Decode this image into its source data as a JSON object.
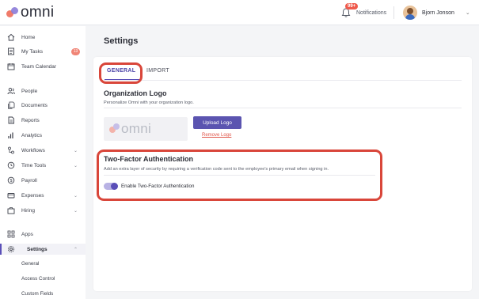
{
  "app": {
    "logo_text": "omni"
  },
  "header": {
    "notifications_label": "Notifications",
    "notifications_badge": "99+",
    "user_name": "Bjorn Jonson"
  },
  "sidebar": {
    "items": [
      {
        "label": "Home",
        "icon": "home-icon"
      },
      {
        "label": "My Tasks",
        "icon": "tasks-icon",
        "badge": "13"
      },
      {
        "label": "Team Calendar",
        "icon": "calendar-icon"
      },
      {
        "label": "People",
        "icon": "people-icon"
      },
      {
        "label": "Documents",
        "icon": "documents-icon"
      },
      {
        "label": "Reports",
        "icon": "reports-icon"
      },
      {
        "label": "Analytics",
        "icon": "analytics-icon"
      },
      {
        "label": "Workflows",
        "icon": "workflows-icon"
      },
      {
        "label": "Time Tools",
        "icon": "clock-icon"
      },
      {
        "label": "Payroll",
        "icon": "payroll-icon"
      },
      {
        "label": "Expenses",
        "icon": "expenses-icon"
      },
      {
        "label": "Hiring",
        "icon": "hiring-icon"
      },
      {
        "label": "Apps",
        "icon": "apps-icon"
      },
      {
        "label": "Settings",
        "icon": "gear-icon"
      }
    ],
    "settings_sub": [
      "General",
      "Access Control",
      "Custom Fields"
    ]
  },
  "main": {
    "page_title": "Settings",
    "tabs": [
      "GENERAL",
      "IMPORT"
    ],
    "org_logo": {
      "title": "Organization Logo",
      "description": "Personalize Omni with your organization logo.",
      "preview_text": "omni",
      "upload_label": "Upload Logo",
      "remove_label": "Remove Logo"
    },
    "two_factor": {
      "title": "Two-Factor Authentication",
      "description": "Add an extra layer of security by requiring a verification code sent to the employee's primary email when signing in.",
      "toggle_label": "Enable Two-Factor Authentication",
      "enabled": true
    }
  },
  "colors": {
    "accent": "#5a4fb8",
    "annotation": "#d9463a",
    "danger": "#e0564a"
  }
}
